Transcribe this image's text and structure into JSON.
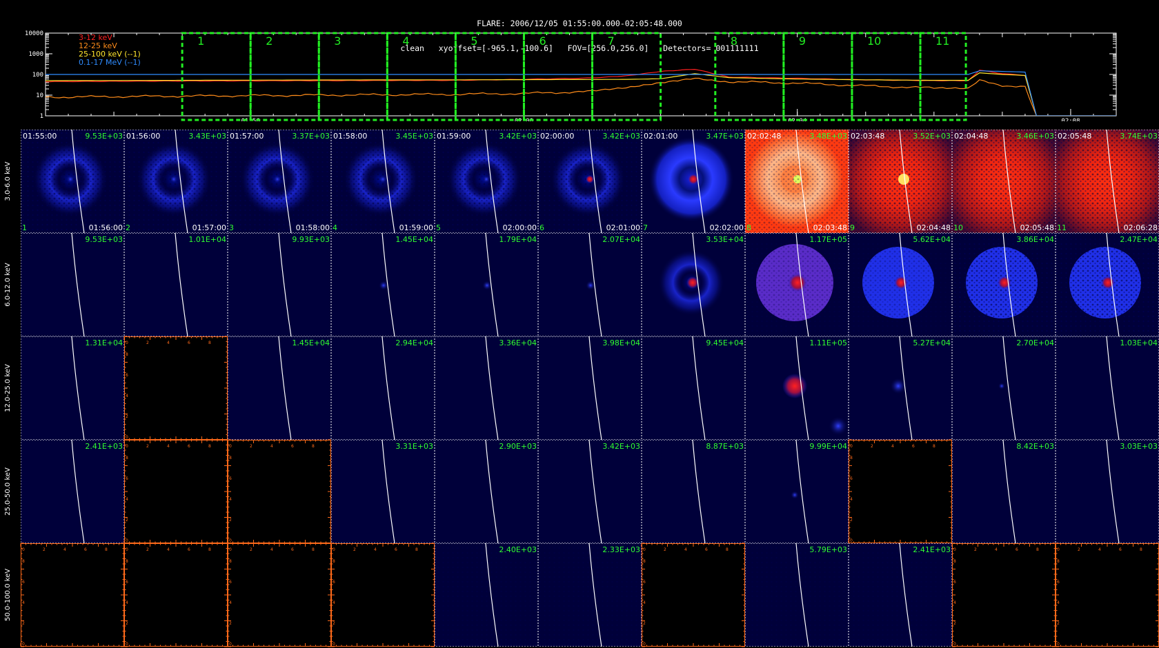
{
  "header": {
    "line1": "FLARE: 2006/12/05 01:55:00.000-02:05:48.000",
    "line2": "clean   xyoffset=[-965.1,-100.6]   FOV=[256.0,256.0]   Detectors= 001111111"
  },
  "lightcurve": {
    "legend": [
      {
        "label": "3-12 keV",
        "color": "#ff2020"
      },
      {
        "label": "12-25 keV",
        "color": "#ff8c1a"
      },
      {
        "label": "25-100 keV (--1)",
        "color": "#ffe62e"
      },
      {
        "label": "0.1-17 MeV (--1)",
        "color": "#2f8cff"
      }
    ],
    "y_ticks": [
      "10000",
      "1000",
      "100",
      "10",
      "1"
    ],
    "x_ticks": [
      "01:56",
      "02:00",
      "02:04",
      "02:08"
    ],
    "interval_labels": [
      "1",
      "2",
      "3",
      "4",
      "5",
      "6",
      "7",
      "8",
      "9",
      "10",
      "11"
    ],
    "interval_color": "#22ee22"
  },
  "chart_data": {
    "type": "line",
    "title": "FLARE: 2006/12/05 01:55:00.000-02:05:48.000",
    "xlabel": "",
    "ylabel": "",
    "x_range": [
      "01:53:00",
      "02:08:40"
    ],
    "y_scale": "log",
    "ylim": [
      1,
      10000
    ],
    "x": [
      "01:53:00",
      "01:55:00",
      "01:57:00",
      "01:59:00",
      "02:00:00",
      "02:01:00",
      "02:01:30",
      "02:02:00",
      "02:02:30",
      "02:03:00",
      "02:04:00",
      "02:05:00",
      "02:06:00",
      "02:06:30",
      "02:06:40",
      "02:07:00",
      "02:07:20",
      "02:07:30",
      "02:08:40"
    ],
    "series": [
      {
        "name": "3-12 keV",
        "values": [
          45,
          48,
          50,
          52,
          58,
          68,
          85,
          140,
          180,
          75,
          65,
          55,
          50,
          50,
          160,
          110,
          90,
          1,
          1
        ]
      },
      {
        "name": "12-25 keV",
        "values": [
          8,
          9,
          10,
          11,
          12,
          15,
          22,
          40,
          70,
          45,
          38,
          28,
          22,
          22,
          50,
          30,
          25,
          1,
          1
        ]
      },
      {
        "name": "25-100 keV (--1)",
        "values": [
          50,
          52,
          54,
          55,
          56,
          57,
          58,
          62,
          110,
          70,
          60,
          55,
          52,
          52,
          120,
          100,
          90,
          1,
          1
        ]
      },
      {
        "name": "0.1-17 MeV (--1)",
        "values": [
          100,
          100,
          100,
          100,
          100,
          100,
          100,
          100,
          100,
          100,
          100,
          100,
          100,
          100,
          150,
          140,
          130,
          1,
          1
        ]
      }
    ]
  },
  "grid": {
    "energy_bands": [
      "3.0-6.0 keV",
      "6.0-12.0 keV",
      "12.0-25.0 keV",
      "25.0-50.0 keV",
      "50.0-100.0 keV"
    ],
    "interval_start_times": [
      "01:55:00",
      "01:56:00",
      "01:57:00",
      "01:58:00",
      "01:59:00",
      "02:00:00",
      "02:01:00",
      "02:02:48",
      "02:03:48",
      "02:04:48",
      "02:05:48"
    ],
    "interval_end_times": [
      "01:56:00",
      "01:57:00",
      "01:58:00",
      "01:59:00",
      "02:00:00",
      "02:01:00",
      "02:02:00",
      "02:03:48",
      "02:04:48",
      "02:05:48",
      "02:06:28"
    ],
    "interval_numbers": [
      "1",
      "2",
      "3",
      "4",
      "5",
      "6",
      "7",
      "8",
      "9",
      "10",
      "11"
    ],
    "max_values": [
      [
        "9.53E+03",
        "3.43E+03",
        "3.37E+03",
        "3.45E+03",
        "3.42E+03",
        "3.42E+03",
        "3.47E+03",
        "3.48E+03",
        "3.52E+03",
        "3.46E+03",
        "3.74E+03"
      ],
      [
        "9.53E+03",
        "1.01E+04",
        "9.93E+03",
        "1.45E+04",
        "1.79E+04",
        "2.07E+04",
        "3.53E+04",
        "1.17E+05",
        "5.62E+04",
        "3.86E+04",
        "2.47E+04"
      ],
      [
        "1.31E+04",
        "",
        "1.45E+04",
        "2.94E+04",
        "3.36E+04",
        "3.98E+04",
        "9.45E+04",
        "1.11E+05",
        "5.27E+04",
        "2.70E+04",
        "1.03E+04"
      ],
      [
        "2.41E+03",
        "",
        "",
        "3.31E+03",
        "2.90E+03",
        "3.42E+03",
        "8.87E+03",
        "9.99E+04",
        "",
        "8.42E+03",
        "3.03E+03"
      ],
      [
        "",
        "",
        "",
        "",
        "2.40E+03",
        "2.33E+03",
        "",
        "5.79E+03",
        "2.41E+03",
        "",
        ""
      ]
    ],
    "empty_tick_labels": [
      "0",
      "2",
      "4",
      "6",
      "8"
    ],
    "colors": {
      "time_text": "#ffffff",
      "max_text": "#30ff30",
      "image_bg": "#00003a",
      "empty_axis": "#ff6a1a",
      "dotted_border": "#ffffff"
    }
  }
}
